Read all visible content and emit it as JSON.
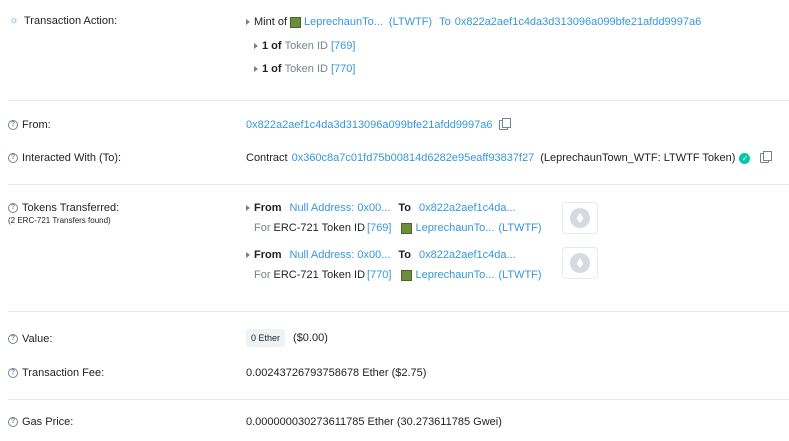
{
  "transaction_action": {
    "label": "Transaction Action:",
    "mint_of": "Mint of",
    "token_name": "LeprechaunTo...",
    "token_symbol": "(LTWTF)",
    "to_word": "To",
    "to_address": "0x822a2aef1c4da3d313096a099bfe21afdd9997a6",
    "items": [
      {
        "count": "1 of",
        "token_id_label": "Token ID",
        "token_id": "[769]"
      },
      {
        "count": "1 of",
        "token_id_label": "Token ID",
        "token_id": "[770]"
      }
    ]
  },
  "from": {
    "label": "From:",
    "address": "0x822a2aef1c4da3d313096a099bfe21afdd9997a6"
  },
  "interacted_with": {
    "label": "Interacted With (To):",
    "contract_word": "Contract",
    "contract_address": "0x360c8a7c01fd75b00814d6282e95eaff93837f27",
    "contract_name": "(LeprechaunTown_WTF: LTWTF Token)"
  },
  "tokens_transferred": {
    "label": "Tokens Transferred:",
    "sublabel": "(2 ERC-721 Transfers found)",
    "transfers": [
      {
        "from_word": "From",
        "from_address": "Null Address: 0x00...",
        "to_word": "To",
        "to_address": "0x822a2aef1c4da...",
        "for_word": "For",
        "token_type": "ERC-721 Token ID",
        "token_id": "[769]",
        "token_name": "LeprechaunTo...",
        "token_symbol": "(LTWTF)"
      },
      {
        "from_word": "From",
        "from_address": "Null Address: 0x00...",
        "to_word": "To",
        "to_address": "0x822a2aef1c4da...",
        "for_word": "For",
        "token_type": "ERC-721 Token ID",
        "token_id": "[770]",
        "token_name": "LeprechaunTo...",
        "token_symbol": "(LTWTF)"
      }
    ]
  },
  "value": {
    "label": "Value:",
    "ether": "0 Ether",
    "usd": "($0.00)"
  },
  "transaction_fee": {
    "label": "Transaction Fee:",
    "value": "0.00243726793758678 Ether ($2.75)"
  },
  "gas_price": {
    "label": "Gas Price:",
    "value": "0.000000030273611785 Ether (30.273611785 Gwei)"
  },
  "icons": {
    "help": "question-circle-icon",
    "bulb": "lightbulb-icon",
    "copy": "copy-icon",
    "verified": "check-circle-icon",
    "eth": "ethereum-icon"
  },
  "colors": {
    "link": "#3498db",
    "muted": "#77838f",
    "verified": "#00c9a7"
  }
}
